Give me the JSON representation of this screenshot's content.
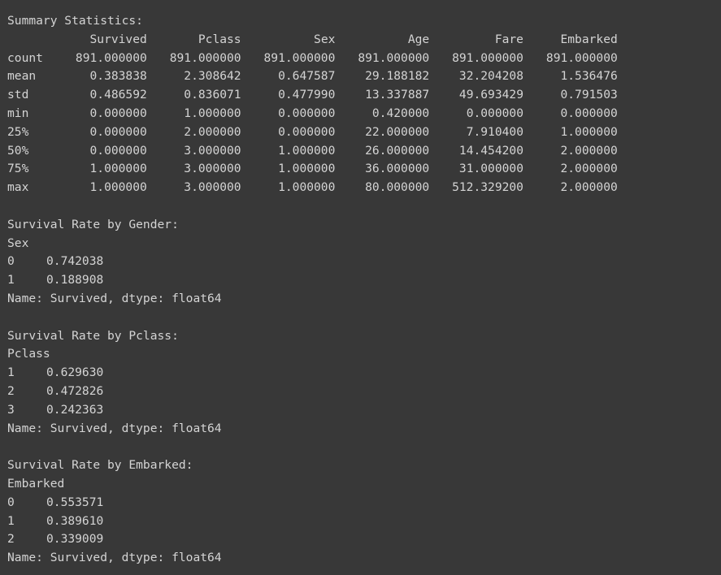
{
  "summary": {
    "title": "Summary Statistics:",
    "columns": [
      "Survived",
      "Pclass",
      "Sex",
      "Age",
      "Fare",
      "Embarked"
    ],
    "rows": [
      {
        "label": "count",
        "values": [
          "891.000000",
          "891.000000",
          "891.000000",
          "891.000000",
          "891.000000",
          "891.000000"
        ]
      },
      {
        "label": "mean",
        "values": [
          "0.383838",
          "2.308642",
          "0.647587",
          "29.188182",
          "32.204208",
          "1.536476"
        ]
      },
      {
        "label": "std",
        "values": [
          "0.486592",
          "0.836071",
          "0.477990",
          "13.337887",
          "49.693429",
          "0.791503"
        ]
      },
      {
        "label": "min",
        "values": [
          "0.000000",
          "1.000000",
          "0.000000",
          "0.420000",
          "0.000000",
          "0.000000"
        ]
      },
      {
        "label": "25%",
        "values": [
          "0.000000",
          "2.000000",
          "0.000000",
          "22.000000",
          "7.910400",
          "1.000000"
        ]
      },
      {
        "label": "50%",
        "values": [
          "0.000000",
          "3.000000",
          "1.000000",
          "26.000000",
          "14.454200",
          "2.000000"
        ]
      },
      {
        "label": "75%",
        "values": [
          "1.000000",
          "3.000000",
          "1.000000",
          "36.000000",
          "31.000000",
          "2.000000"
        ]
      },
      {
        "label": "max",
        "values": [
          "1.000000",
          "3.000000",
          "1.000000",
          "80.000000",
          "512.329200",
          "2.000000"
        ]
      }
    ]
  },
  "gender": {
    "title": "Survival Rate by Gender:",
    "index_name": "Sex",
    "rows": [
      {
        "key": "0",
        "value": "0.742038"
      },
      {
        "key": "1",
        "value": "0.188908"
      }
    ],
    "footer": "Name: Survived, dtype: float64"
  },
  "pclass": {
    "title": "Survival Rate by Pclass:",
    "index_name": "Pclass",
    "rows": [
      {
        "key": "1",
        "value": "0.629630"
      },
      {
        "key": "2",
        "value": "0.472826"
      },
      {
        "key": "3",
        "value": "0.242363"
      }
    ],
    "footer": "Name: Survived, dtype: float64"
  },
  "embarked": {
    "title": "Survival Rate by Embarked:",
    "index_name": "Embarked",
    "rows": [
      {
        "key": "0",
        "value": "0.553571"
      },
      {
        "key": "1",
        "value": "0.389610"
      },
      {
        "key": "2",
        "value": "0.339009"
      }
    ],
    "footer": "Name: Survived, dtype: float64"
  }
}
